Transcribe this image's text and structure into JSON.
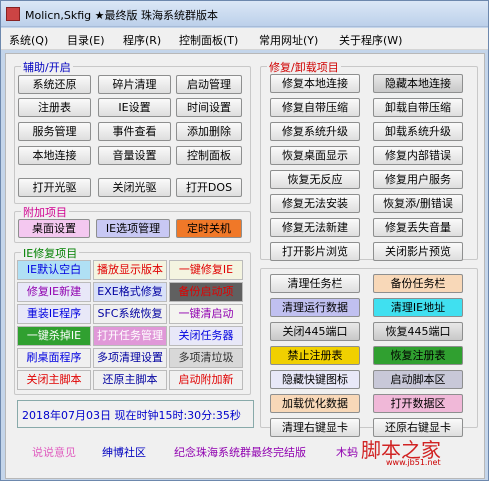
{
  "window": {
    "title": "Molicn,Skfig ★最终版 珠海系统群版本"
  },
  "menu": [
    "系统(Q)",
    "目录(E)",
    "程序(R)",
    "控制面板(T)",
    "常用网址(Y)",
    "关于程序(W)"
  ],
  "groups": {
    "aux": "辅助/开启",
    "repair": "修复/卸载项目",
    "extra": "附加项目",
    "ie": "IE修复项目"
  },
  "aux_buttons": [
    "系统还原",
    "碎片清理",
    "启动管理",
    "注册表",
    "IE设置",
    "时间设置",
    "服务管理",
    "事件查看",
    "添加删除",
    "本地连接",
    "音量设置",
    "控制面板",
    "打开光驱",
    "关闭光驱",
    "打开DOS"
  ],
  "repair_buttons": [
    "修复本地连接",
    "隐藏本地连接",
    "修复自带压缩",
    "卸载自带压缩",
    "修复系统升级",
    "卸载系统升级",
    "恢复桌面显示",
    "修复内部错误",
    "恢复无反应",
    "修复用户服务",
    "修复无法安装",
    "恢复添/删错误",
    "修复无法新建",
    "修复丢失音量",
    "打开影片浏览",
    "关闭影片预览"
  ],
  "extra_buttons": [
    "桌面设置",
    "IE选项管理",
    "定时关机"
  ],
  "ie_cells": [
    "IE默认空白",
    "播放显示版本",
    "一键修复IE",
    "修复IE新建",
    "EXE格式修复",
    "备份启动项",
    "重装IE程序",
    "SFC系统恢复",
    "一键清启动",
    "一键杀掉IE",
    "打开任务管理",
    "关闭任务器",
    "刷桌面程序",
    "多项清理设置",
    "多项清垃圾",
    "关闭主脚本",
    "还原主脚本",
    "启动附加新"
  ],
  "bottom_buttons": [
    "清理任务栏",
    "备份任务栏",
    "清理运行数据",
    "清理IE地址",
    "关闭445端口",
    "恢复445端口",
    "禁止注册表",
    "恢复注册表",
    "隐藏快键图标",
    "启动脚本区",
    "加载优化数据",
    "打开数据区",
    "清理右键显卡",
    "还原右键显卡"
  ],
  "status": "2018年07月03日  现在时钟15时:30分:35秒",
  "footer": [
    "说说意见",
    "绅博社区",
    "纪念珠海系统群最终完结版",
    "木蚂"
  ],
  "watermark": "脚本之家",
  "watermark_url": "www.jb51.net",
  "colors": {
    "red": "#e00000",
    "blue": "#0000e0",
    "purple": "#9000b0",
    "pink": "#e060c0",
    "green": "#008000",
    "grey": "#808080"
  }
}
